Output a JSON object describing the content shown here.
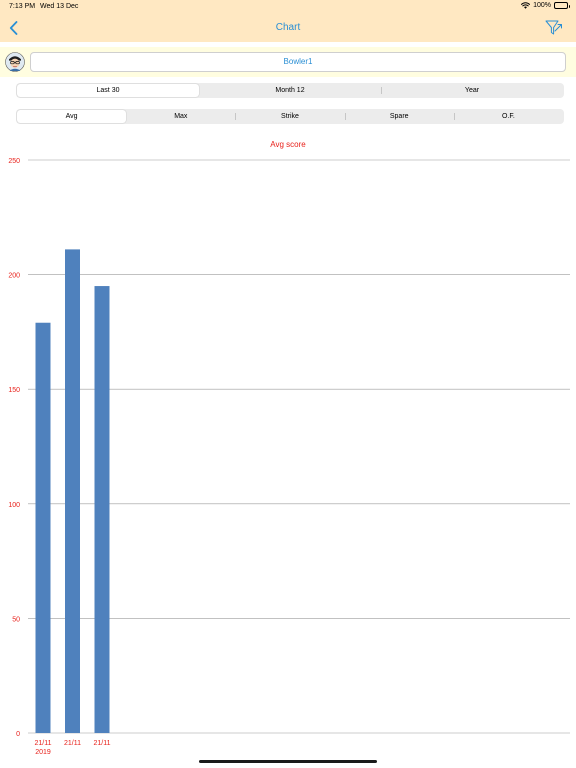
{
  "status_bar": {
    "time": "7:13 PM",
    "date": "Wed 13 Dec",
    "battery_percent": "100%",
    "battery_level": 1.0
  },
  "nav": {
    "title": "Chart",
    "back_icon": "chevron-left-icon",
    "filter_icon": "filter-icon"
  },
  "bowler": {
    "name": "Bowler1",
    "avatar_icon": "bowler-avatar-icon"
  },
  "period_tabs": [
    {
      "label": "Last 30",
      "selected": true
    },
    {
      "label": "Month 12",
      "selected": false
    },
    {
      "label": "Year",
      "selected": false
    }
  ],
  "metric_tabs": [
    {
      "label": "Avg",
      "selected": true
    },
    {
      "label": "Max",
      "selected": false
    },
    {
      "label": "Strike",
      "selected": false
    },
    {
      "label": "Spare",
      "selected": false
    },
    {
      "label": "O.F.",
      "selected": false
    }
  ],
  "colors": {
    "accent": "#2a8fd4",
    "bar": "#4f81bd",
    "axis_label": "#e8201a",
    "nav_bg": "#ffe8c2",
    "bowler_row_bg": "#fffde0"
  },
  "chart_data": {
    "type": "bar",
    "title": "Avg score",
    "categories": [
      "21/11\n2019",
      "21/11",
      "21/11"
    ],
    "values": [
      179,
      211,
      195
    ],
    "ylim": [
      0,
      250
    ],
    "yticks": [
      0,
      50,
      100,
      150,
      200,
      250
    ],
    "grid": true,
    "xlabel": "",
    "ylabel": ""
  }
}
